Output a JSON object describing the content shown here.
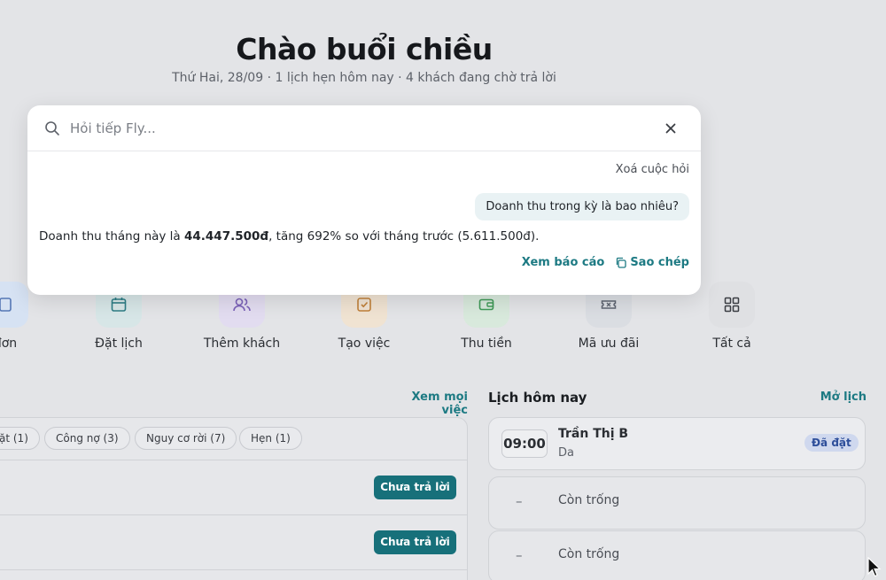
{
  "greeting": {
    "title": "Chào buổi chiều",
    "subtitle": "Thứ Hai, 28/09 · 1 lịch hẹn hôm nay · 4 khách đang chờ trả lời"
  },
  "search": {
    "placeholder": "Hỏi tiếp Fly...",
    "value": "",
    "clear_conversation": "Xoá cuộc hỏi",
    "user_question": "Doanh thu trong kỳ là bao nhiêu?",
    "answer": {
      "prefix": "Doanh thu tháng này là ",
      "amount": "44.447.500đ",
      "suffix": ", tăng 692% so với tháng trước (5.611.500đ)."
    },
    "actions": {
      "view_report": "Xem báo cáo",
      "copy": "Sao chép"
    }
  },
  "quick_actions": [
    {
      "label": "đơn",
      "icon": "receipt-icon",
      "color": "#d6e2f3"
    },
    {
      "label": "Đặt lịch",
      "icon": "calendar-icon",
      "color": "#d7e6e7"
    },
    {
      "label": "Thêm khách",
      "icon": "users-icon",
      "color": "#e2dcf0"
    },
    {
      "label": "Tạo việc",
      "icon": "checkbox-icon",
      "color": "#f0e3d2"
    },
    {
      "label": "Thu tiền",
      "icon": "wallet-icon",
      "color": "#d8e9dc"
    },
    {
      "label": "Mã ưu đãi",
      "icon": "ticket-icon",
      "color": "#dadde2"
    },
    {
      "label": "Tất cả",
      "icon": "grid-icon",
      "color": "#dfe0e3"
    }
  ],
  "tasks": {
    "view_all": "Xem mọi việc",
    "chips": [
      "ặt (1)",
      "Công nợ (3)",
      "Nguy cơ rời (7)",
      "Hẹn (1)"
    ],
    "rows": [
      {
        "action": "Chưa trả lời"
      },
      {
        "action": "Chưa trả lời"
      }
    ]
  },
  "schedule": {
    "title": "Lịch hôm nay",
    "open_calendar": "Mở lịch",
    "slots": [
      {
        "time": "09:00",
        "customer": "Trần Thị B",
        "service": "Da",
        "status": "Đã đặt"
      },
      {
        "time": "–",
        "label": "Còn trống"
      },
      {
        "time": "–",
        "label": "Còn trống"
      }
    ]
  },
  "colors": {
    "accent": "#17707a",
    "link": "#1d7a83",
    "background": "#e3e4e7"
  }
}
